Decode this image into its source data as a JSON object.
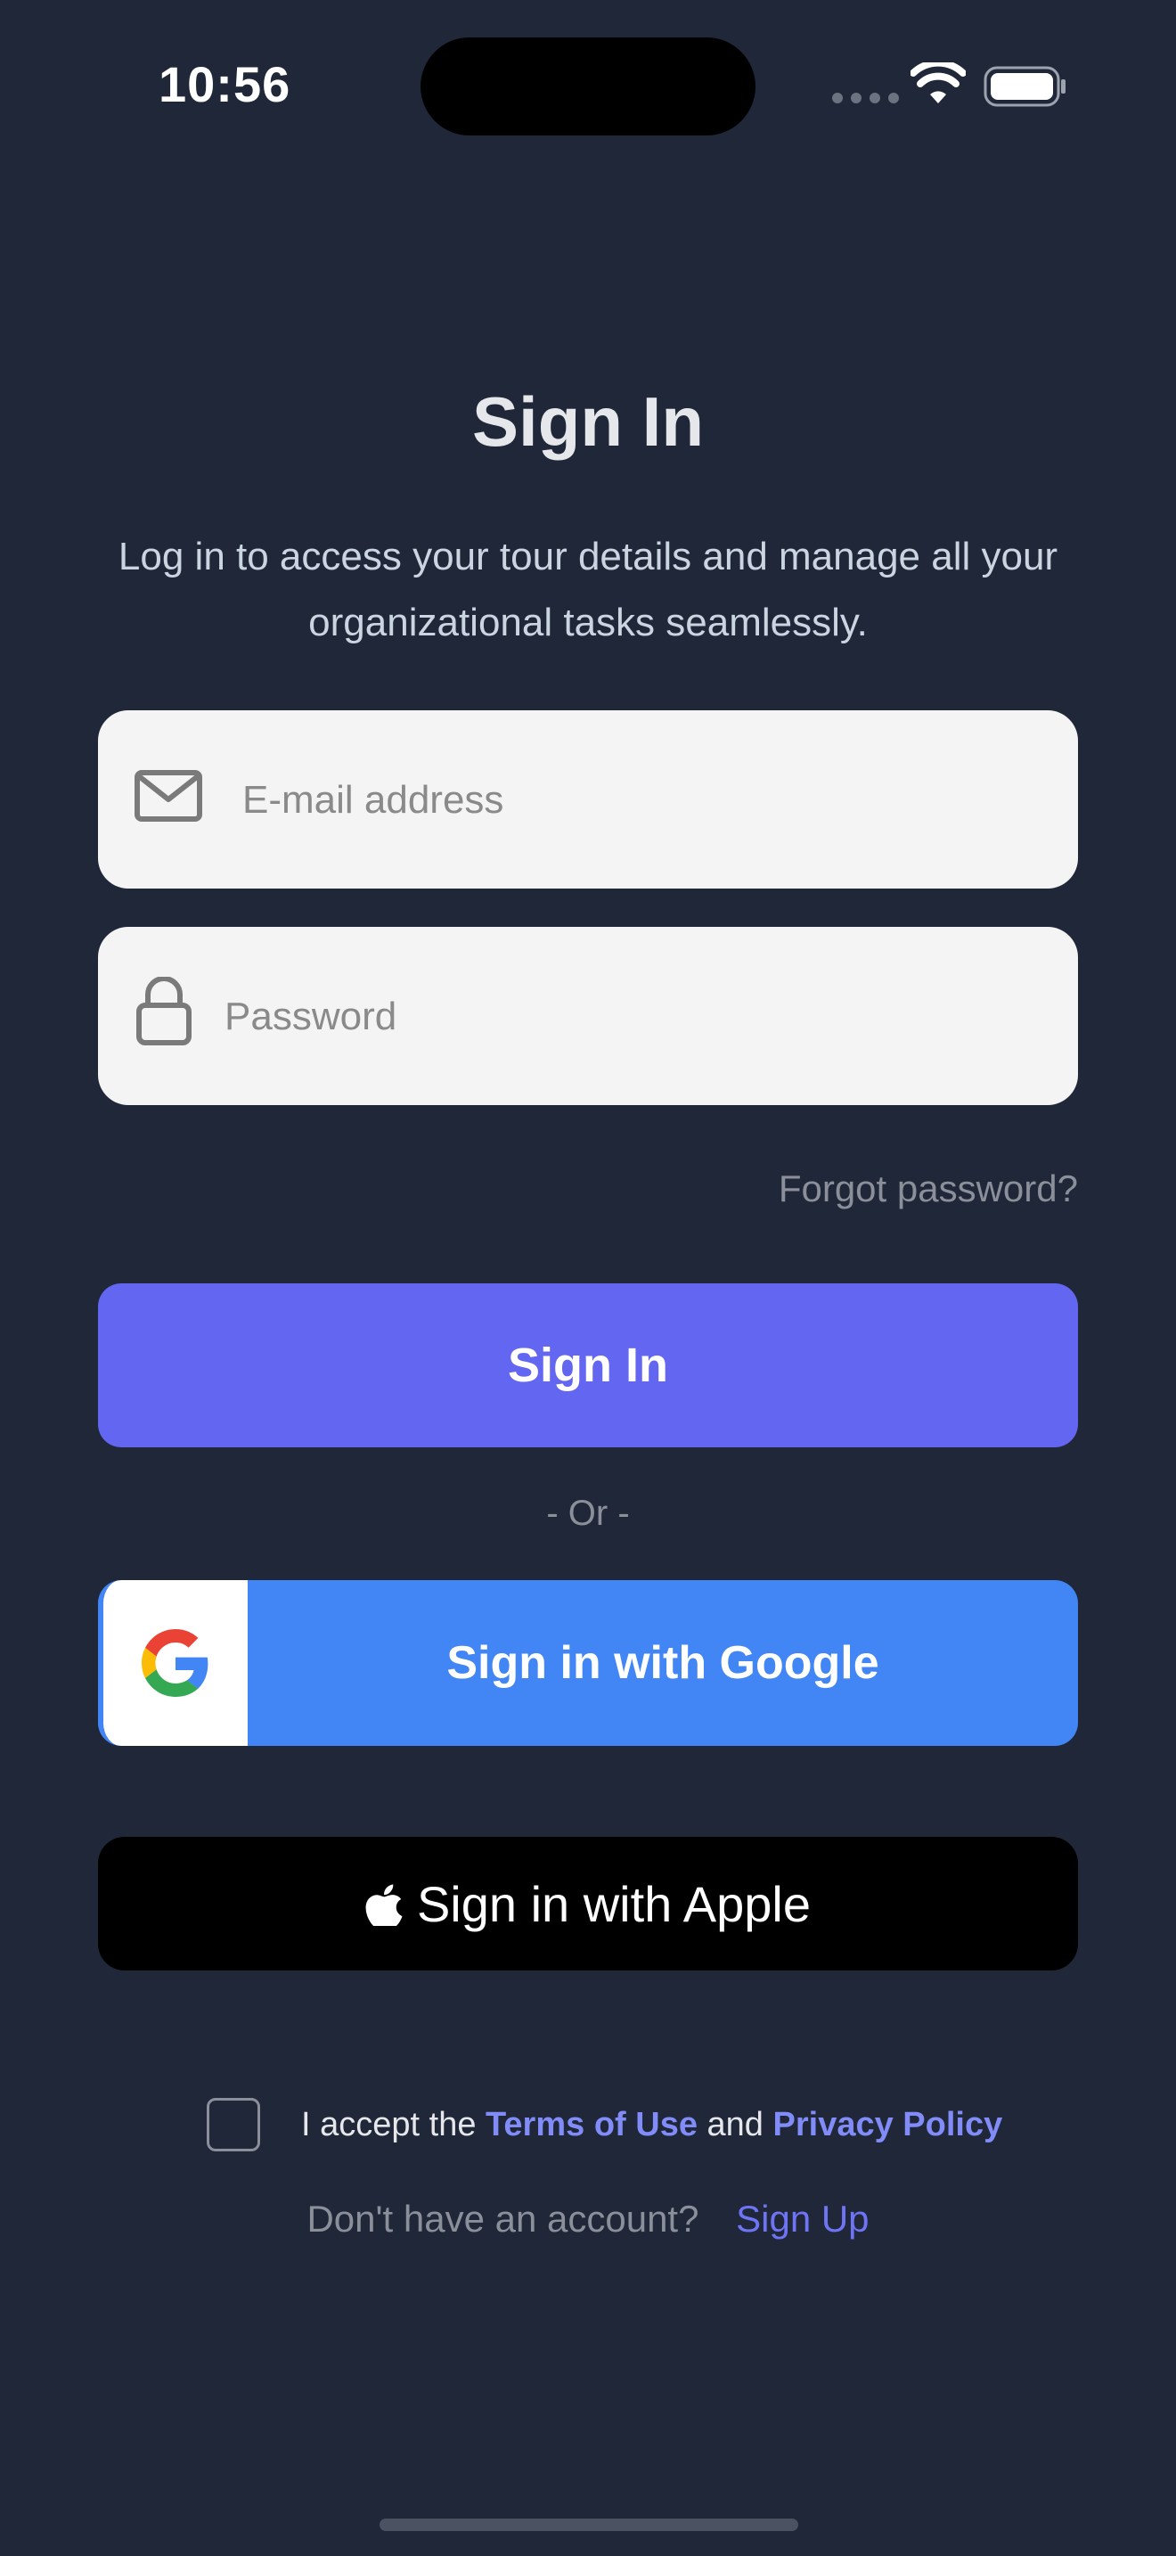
{
  "status_bar": {
    "time": "10:56"
  },
  "header": {
    "title": "Sign In",
    "subtitle": "Log in to access your tour details and manage all your organizational tasks seamlessly."
  },
  "form": {
    "email_placeholder": "E-mail address",
    "email_value": "",
    "password_placeholder": "Password",
    "password_value": "",
    "forgot_password": "Forgot password?",
    "signin_button": "Sign In"
  },
  "divider": {
    "or_text": "- Or -"
  },
  "social": {
    "google_label": "Sign in with Google",
    "apple_label": "Sign in with Apple"
  },
  "terms": {
    "prefix": "I accept the",
    "terms_link": "Terms of Use",
    "and": "and",
    "privacy_link": "Privacy Policy",
    "checked": false
  },
  "signup": {
    "prompt": "Don't have an account?",
    "link": "Sign Up"
  },
  "colors": {
    "background": "#1f2738",
    "primary": "#6366f1",
    "google_blue": "#4285f4",
    "link": "#818cf8",
    "input_bg": "#f4f4f4"
  }
}
